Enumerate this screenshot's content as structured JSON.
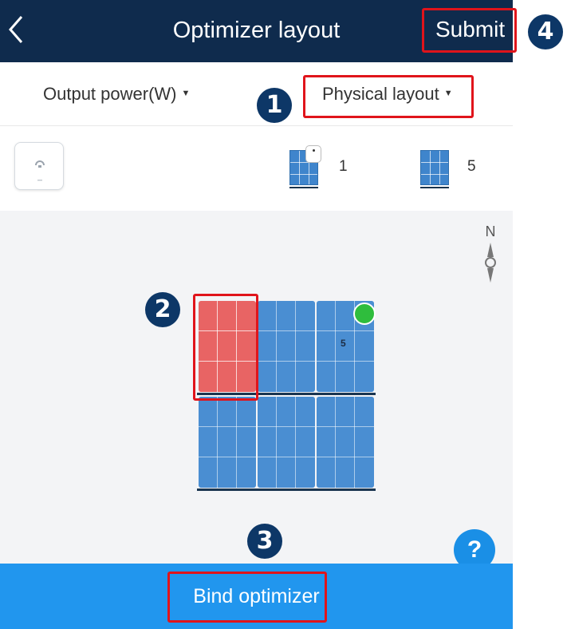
{
  "header": {
    "title": "Optimizer layout",
    "submit_label": "Submit",
    "back_icon": "chevron-left-icon"
  },
  "filters": {
    "output_power": "Output power(W)",
    "layout_mode": "Physical layout",
    "caret": "▼"
  },
  "tools": {
    "optimizer_count": "1",
    "panel_count": "5"
  },
  "compass": {
    "label": "N"
  },
  "panels": [
    {
      "row": 1,
      "col": 1,
      "selected": true,
      "label": ""
    },
    {
      "row": 1,
      "col": 2,
      "selected": false,
      "label": ""
    },
    {
      "row": 1,
      "col": 3,
      "selected": false,
      "label": "5",
      "has_optimizer": true
    },
    {
      "row": 2,
      "col": 1,
      "selected": false,
      "label": ""
    },
    {
      "row": 2,
      "col": 2,
      "selected": false,
      "label": ""
    },
    {
      "row": 2,
      "col": 3,
      "selected": false,
      "label": ""
    }
  ],
  "help": {
    "label": "?"
  },
  "bottom": {
    "bind_label": "Bind optimizer"
  },
  "annotations": [
    {
      "number": "1",
      "target": "Physical layout"
    },
    {
      "number": "2",
      "target": "selected panel"
    },
    {
      "number": "3",
      "target": "Bind optimizer"
    },
    {
      "number": "4",
      "target": "Submit"
    }
  ],
  "colors": {
    "header_bg": "#0f2b4d",
    "bind_bar": "#2196ee",
    "panel_blue": "#4a8ed2",
    "panel_selected": "#e86464",
    "optimizer_dot": "#2fbd3d",
    "callout_red": "#e0141b",
    "badge_navy": "#0d3767"
  }
}
